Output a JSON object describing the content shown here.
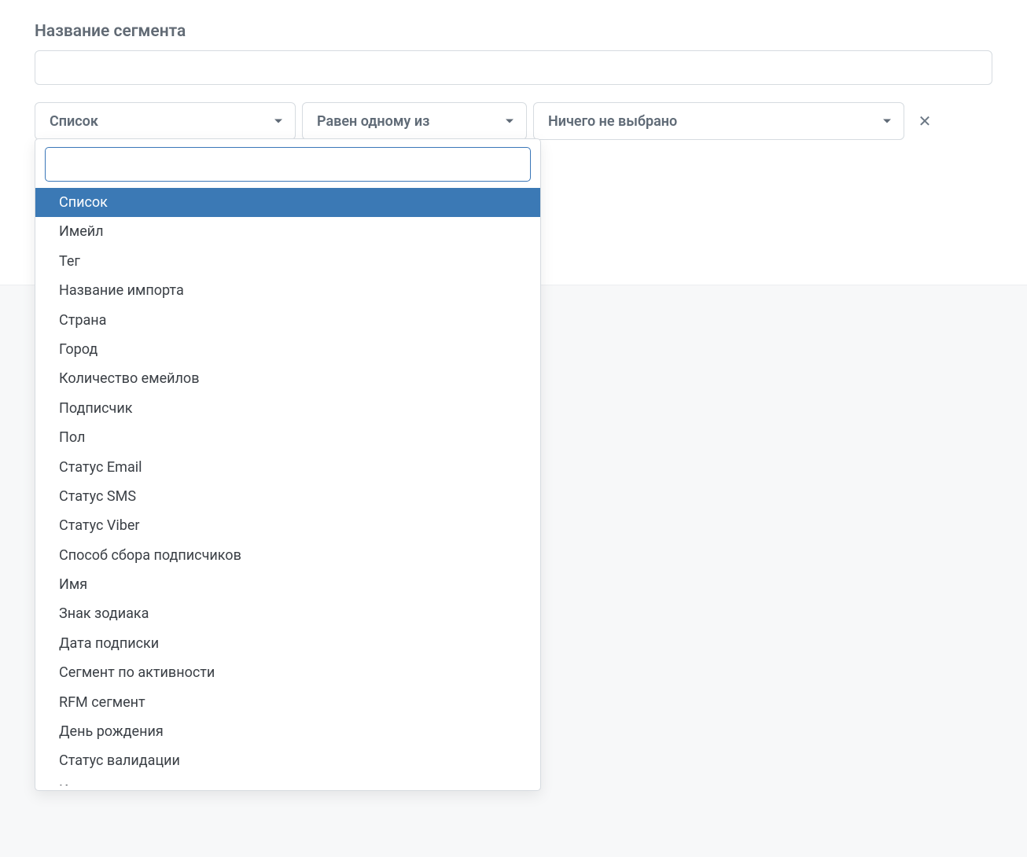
{
  "segment": {
    "label": "Название сегмента",
    "name_value": ""
  },
  "filter": {
    "field_label": "Список",
    "operator_label": "Равен одному из",
    "value_label": "Ничего не выбрано"
  },
  "dropdown": {
    "search_value": "",
    "selected_index": 0,
    "options": [
      "Список",
      "Имейл",
      "Тег",
      "Название импорта",
      "Страна",
      "Город",
      "Количество емейлов",
      "Подписчик",
      "Пол",
      "Статус Email",
      "Статус SMS",
      "Статус Viber",
      "Способ сбора подписчиков",
      "Имя",
      "Знак зодиака",
      "Дата подписки",
      "Сегмент по активности",
      "RFM сегмент",
      "День рождения",
      "Статус валидации",
      "Категория подписки"
    ]
  }
}
